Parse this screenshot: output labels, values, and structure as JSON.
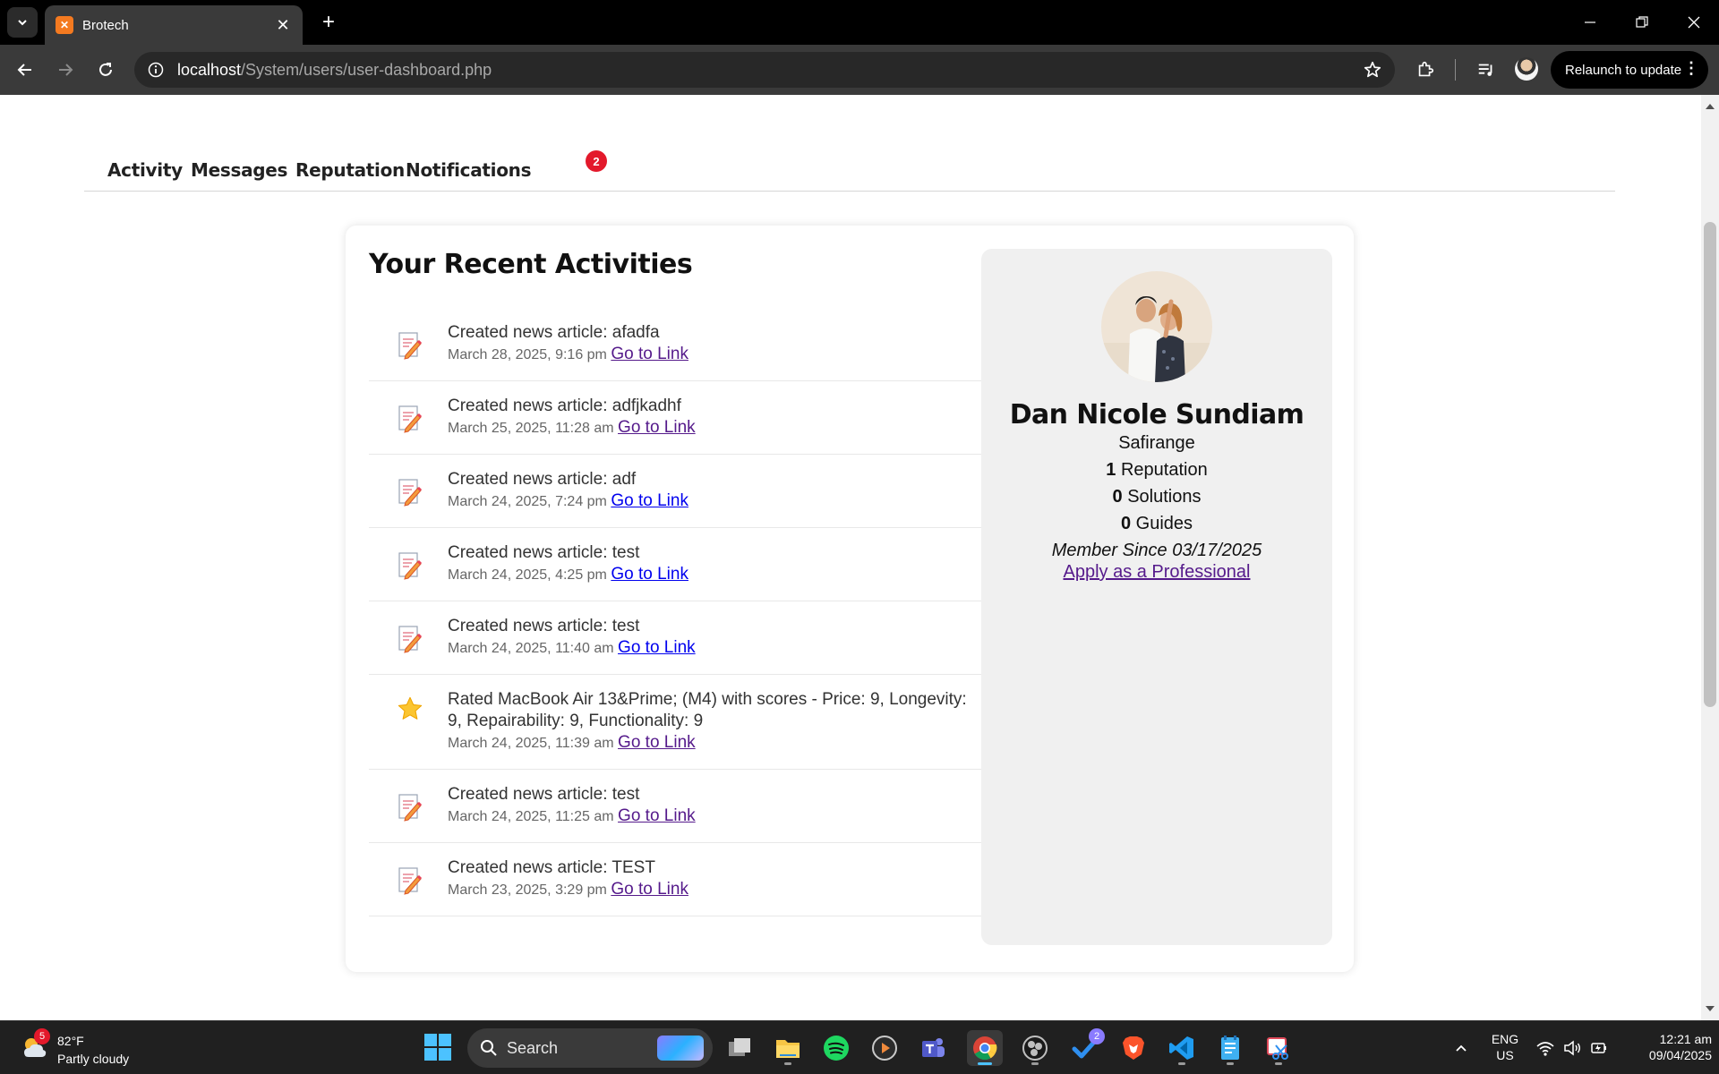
{
  "browser": {
    "tab_title": "Brotech",
    "new_tab": "+",
    "tab_close": "✕",
    "url_host": "localhost",
    "url_path": "/System/users/user-dashboard.php",
    "relaunch_label": "Relaunch to update"
  },
  "nav": {
    "tabs": [
      "Activity",
      "Messages",
      "Reputation",
      "Notifications"
    ],
    "notification_count": "2"
  },
  "activities": {
    "heading": "Your Recent Activities",
    "link_label": "Go to Link",
    "items": [
      {
        "icon": "article-edit-icon",
        "title": "Created news article: afadfa",
        "date": "March 28, 2025, 9:16 pm",
        "link_visited": true
      },
      {
        "icon": "article-edit-icon",
        "title": "Created news article: adfjkadhf",
        "date": "March 25, 2025, 11:28 am",
        "link_visited": true
      },
      {
        "icon": "article-edit-icon",
        "title": "Created news article: adf",
        "date": "March 24, 2025, 7:24 pm",
        "link_visited": false
      },
      {
        "icon": "article-edit-icon",
        "title": "Created news article: test",
        "date": "March 24, 2025, 4:25 pm",
        "link_visited": false
      },
      {
        "icon": "article-edit-icon",
        "title": "Created news article: test",
        "date": "March 24, 2025, 11:40 am",
        "link_visited": false
      },
      {
        "icon": "star-icon",
        "title": "Rated MacBook Air 13&Prime; (M4) with scores - Price: 9, Longevity: 9, Repairability: 9, Functionality: 9",
        "date": "March 24, 2025, 11:39 am",
        "link_visited": true
      },
      {
        "icon": "article-edit-icon",
        "title": "Created news article: test",
        "date": "March 24, 2025, 11:25 am",
        "link_visited": true
      },
      {
        "icon": "article-edit-icon",
        "title": "Created news article: TEST",
        "date": "March 23, 2025, 3:29 pm",
        "link_visited": true
      }
    ]
  },
  "profile": {
    "name": "Dan Nicole Sundiam",
    "location": "Safirange",
    "reputation_count": "1",
    "reputation_label": "Reputation",
    "solutions_count": "0",
    "solutions_label": "Solutions",
    "guides_count": "0",
    "guides_label": "Guides",
    "member_since": "Member Since 03/17/2025",
    "apply_label": "Apply as a Professional"
  },
  "taskbar": {
    "weather_badge": "5",
    "weather_temp": "82°F",
    "weather_desc": "Partly cloudy",
    "search_label": "Search",
    "todo_badge": "2",
    "lang_primary": "ENG",
    "lang_secondary": "US",
    "time": "12:21 am",
    "date": "09/04/2025"
  },
  "colors": {
    "visited_link": "#551a8b",
    "unvisited_link": "#0000ee",
    "badge_red": "#e3192b",
    "panel_bg": "#f0f0f0"
  }
}
